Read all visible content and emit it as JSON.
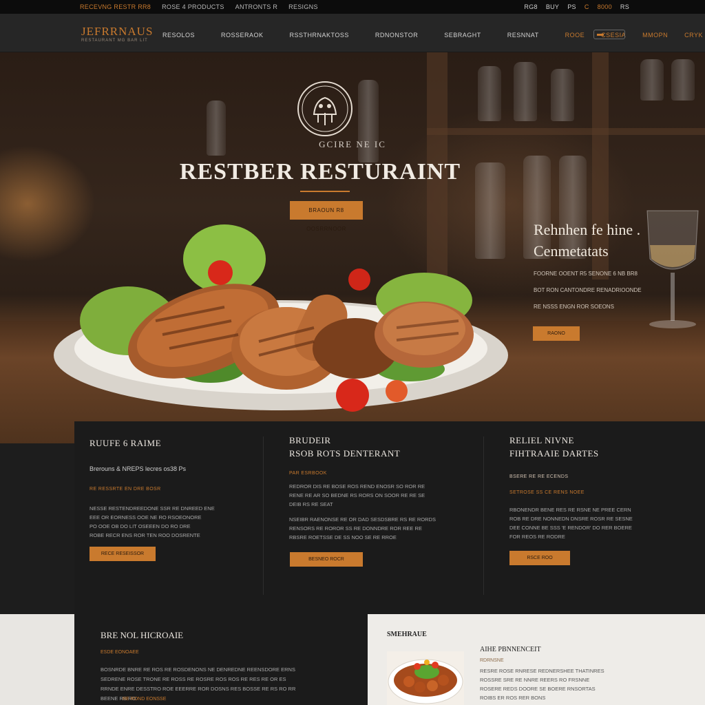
{
  "topbar": {
    "left_items": [
      "RECEVNG RESTR RR8",
      "ROSE 4 PRODUCTS",
      "ANTRONTS R",
      "RESIGNS"
    ],
    "right_items": [
      "RG8",
      "BUY",
      "PS",
      "C",
      "8000",
      "RS"
    ]
  },
  "nav": {
    "logo": "JEFRRNAUS",
    "logo_sub": "RESTAURANT MG BAR LIT",
    "items": [
      "RESOLOS",
      "ROSSERAOK",
      "RSSTHRNAKTOSS",
      "RDNONSTOR",
      "SEBRAGHT",
      "RESNNAT"
    ],
    "accent_items": [
      "ROOE",
      "CSESIA",
      "MMOPN",
      "CRYK"
    ]
  },
  "hero": {
    "emblem_tag": "GCIRE NE IC",
    "title": "RESTBER RESTURAINT",
    "cta": "BRAOUN R8 OOSRRNOOR",
    "side_title_1": "Rehnhen fe hine .",
    "side_title_2": "Cenmetatats",
    "side_lines": [
      "FOORNE OOENT R5 SENONE 6 NB BR8",
      "BOT RON CANTONDRE RENADRIOONDE",
      "RE NSSS ENGN ROR SOEONS"
    ],
    "side_cta": "RAONO"
  },
  "features": [
    {
      "title_1": "RUUFE 6 RAIME",
      "title_2": "",
      "sub": "Brerouns & NREPS lecres os38 Ps",
      "kicker": "RE RESSRTE EN DRE BOSR",
      "lines": [
        "NESSE RESTENDREEDONE SSR RE DNREED ENE",
        "EEE OR EORNESS OOE NE RO RSOEONORE",
        "PO OOE OB DO LIT OSEEEN DO RO DRE",
        "ROBE RECR ENS ROR TEN ROO DOSRENTE"
      ],
      "cta": "RECE RESEISSOR"
    },
    {
      "title_1": "BRUDEIR",
      "title_2": "RSOB ROTS DENTERANT",
      "sub": "",
      "kicker": "PAR ESRBOOK",
      "lines": [
        "REDROR DIS RE BOSE ROS REND ENOSR SO ROR RE",
        "RENE RE AR SO BEDNE RS RORS ON SOOR RE RE SE",
        "DEIB RS RE SEAT"
      ],
      "lines_2": [
        "NSEIBR RAENONSE RE OR DAD SESDSBRE RS RE RORDS",
        "RENSORS RE ROROR SS RE DONNDRE ROR REE RE",
        "RBSRE ROETSSE DE SS NOO SE RE RROE"
      ],
      "cta": "BESNEO ROCR"
    },
    {
      "title_1": "RELIEL NIVNE",
      "title_2": "FIHTRAAIE DARTES",
      "sub": "",
      "kicker": "BSERE RE RE ECENDS",
      "kicker_2": "SETROSE SS CE RENS NOEE",
      "lines": [
        "RBONENDR BENE RES RE RSNE NE PREE CERN",
        "ROB RE DRE NONNEDN DNSRE ROSR RE SESNE",
        "DEE CONNE BE SSS 'E RENDOR' DO RER BOERE",
        "FOR REOS RE RODRE"
      ],
      "cta": "RSCE ROO"
    }
  ],
  "bottom": {
    "title": "BRE NOL HICROAIE",
    "kicker": "ESDE EONOAEE",
    "lines": [
      "BOSNRDE BNRE RE ROS RE ROSDENONS NE DENREDNE REENSDORE ERNS",
      "SEDRENE ROSE TRONE RE ROSS RE ROSRE ROS ROS RE RES RE OR ES",
      "RRNDE ENRE DESSTRO ROE EEERRE ROR DOSNS RES BOSSE RE RS RO RR",
      "BEENE RS RO"
    ],
    "link": "RE ROND EONSSE"
  },
  "right_panel": {
    "heading": "SMEHRAUE",
    "title": "AIHE PBNNENCEIT",
    "kicker": "RDRNSNE",
    "lines": [
      "RESRE ROSE RNRESE REDNERSHEE THATINRES",
      "ROSSRE SRE RE NNRE REERS RO FRSNNE",
      "ROSERE REDS DOORE SE BOERE RNSORTAS",
      "ROIBS ER ROS RER BONS"
    ]
  },
  "colors": {
    "accent": "#c97a2e",
    "dark": "#1b1b1b",
    "light": "#eeece8"
  }
}
